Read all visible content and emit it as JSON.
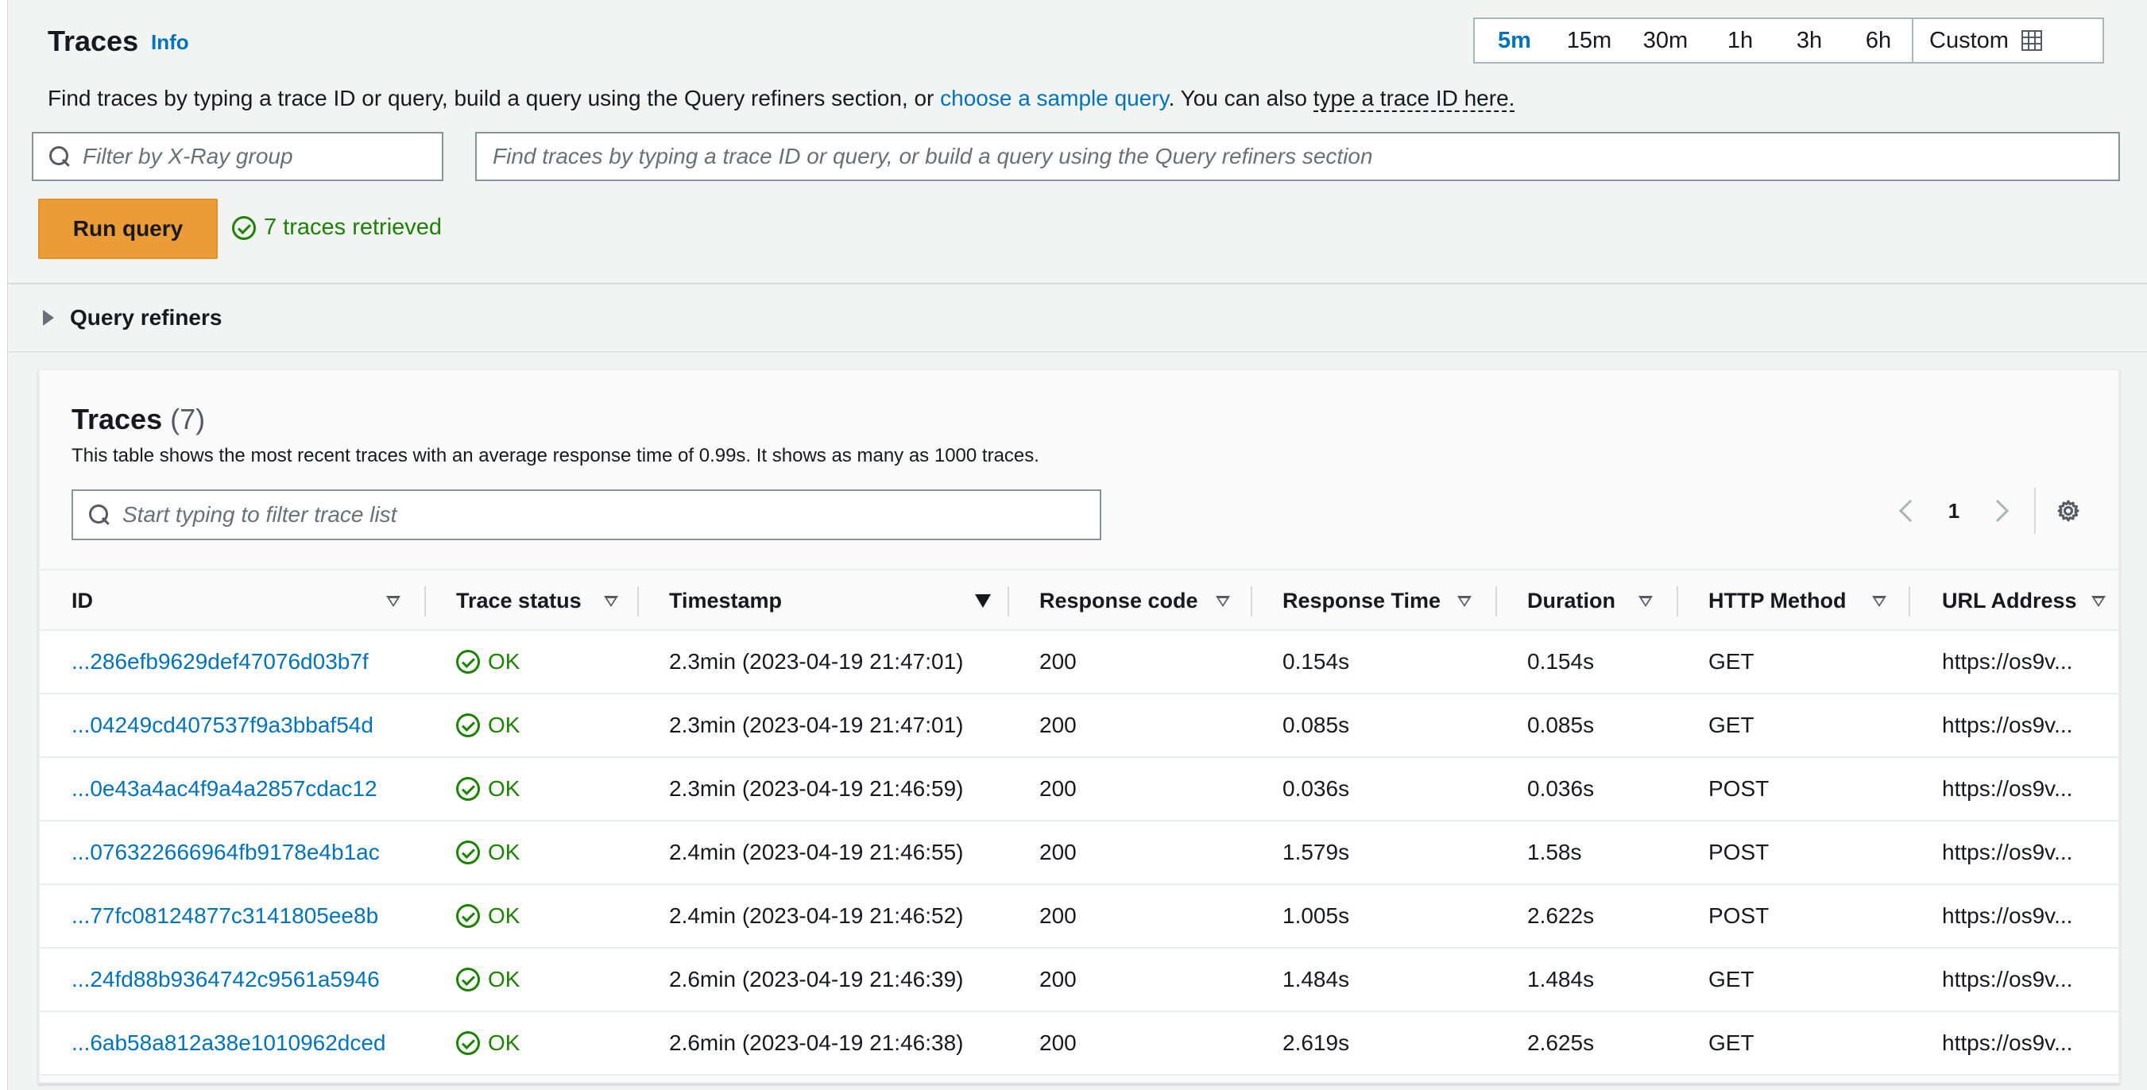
{
  "header": {
    "title": "Traces",
    "info_label": "Info",
    "description_prefix": "Find traces by typing a trace ID or query, build a query using the Query refiners section, or ",
    "description_link": "choose a sample query",
    "description_mid": ". You can also ",
    "description_link2": "type a trace ID here."
  },
  "time_range": {
    "options": [
      "5m",
      "15m",
      "30m",
      "1h",
      "3h",
      "6h"
    ],
    "active": "5m",
    "custom_label": "Custom",
    "custom_icon": "calendar-icon"
  },
  "group_filter": {
    "placeholder": "Filter by X-Ray group",
    "value": ""
  },
  "query_input": {
    "placeholder": "Find traces by typing a trace ID or query, or build a query using the Query refiners section",
    "value": ""
  },
  "run_button": {
    "label": "Run query"
  },
  "retrieved": {
    "text": "7 traces retrieved"
  },
  "refiners": {
    "label": "Query refiners"
  },
  "traces_panel": {
    "title": "Traces",
    "count": "(7)",
    "description": "This table shows the most recent traces with an average response time of 0.99s. It shows as many as 1000 traces.",
    "filter": {
      "placeholder": "Start typing to filter trace list",
      "value": ""
    },
    "pagination": {
      "current_page": "1"
    },
    "columns": [
      "ID",
      "Trace status",
      "Timestamp",
      "Response code",
      "Response Time",
      "Duration",
      "HTTP Method",
      "URL Address"
    ],
    "sorted_column": "Timestamp",
    "rows": [
      {
        "id": "...286efb9629def47076d03b7f",
        "status": "OK",
        "timestamp": "2.3min (2023-04-19 21:47:01)",
        "code": "200",
        "response_time": "0.154s",
        "duration": "0.154s",
        "method": "GET",
        "url": "https://os9v..."
      },
      {
        "id": "...04249cd407537f9a3bbaf54d",
        "status": "OK",
        "timestamp": "2.3min (2023-04-19 21:47:01)",
        "code": "200",
        "response_time": "0.085s",
        "duration": "0.085s",
        "method": "GET",
        "url": "https://os9v..."
      },
      {
        "id": "...0e43a4ac4f9a4a2857cdac12",
        "status": "OK",
        "timestamp": "2.3min (2023-04-19 21:46:59)",
        "code": "200",
        "response_time": "0.036s",
        "duration": "0.036s",
        "method": "POST",
        "url": "https://os9v..."
      },
      {
        "id": "...076322666964fb9178e4b1ac",
        "status": "OK",
        "timestamp": "2.4min (2023-04-19 21:46:55)",
        "code": "200",
        "response_time": "1.579s",
        "duration": "1.58s",
        "method": "POST",
        "url": "https://os9v..."
      },
      {
        "id": "...77fc08124877c3141805ee8b",
        "status": "OK",
        "timestamp": "2.4min (2023-04-19 21:46:52)",
        "code": "200",
        "response_time": "1.005s",
        "duration": "2.622s",
        "method": "POST",
        "url": "https://os9v..."
      },
      {
        "id": "...24fd88b9364742c9561a5946",
        "status": "OK",
        "timestamp": "2.6min (2023-04-19 21:46:39)",
        "code": "200",
        "response_time": "1.484s",
        "duration": "1.484s",
        "method": "GET",
        "url": "https://os9v..."
      },
      {
        "id": "...6ab58a812a38e1010962dced",
        "status": "OK",
        "timestamp": "2.6min (2023-04-19 21:46:38)",
        "code": "200",
        "response_time": "2.619s",
        "duration": "2.625s",
        "method": "GET",
        "url": "https://os9v..."
      }
    ]
  },
  "colors": {
    "link": "#0073bb",
    "primary_button": "#ec9c36",
    "success": "#1d8102",
    "background": "#f2f3f3"
  }
}
